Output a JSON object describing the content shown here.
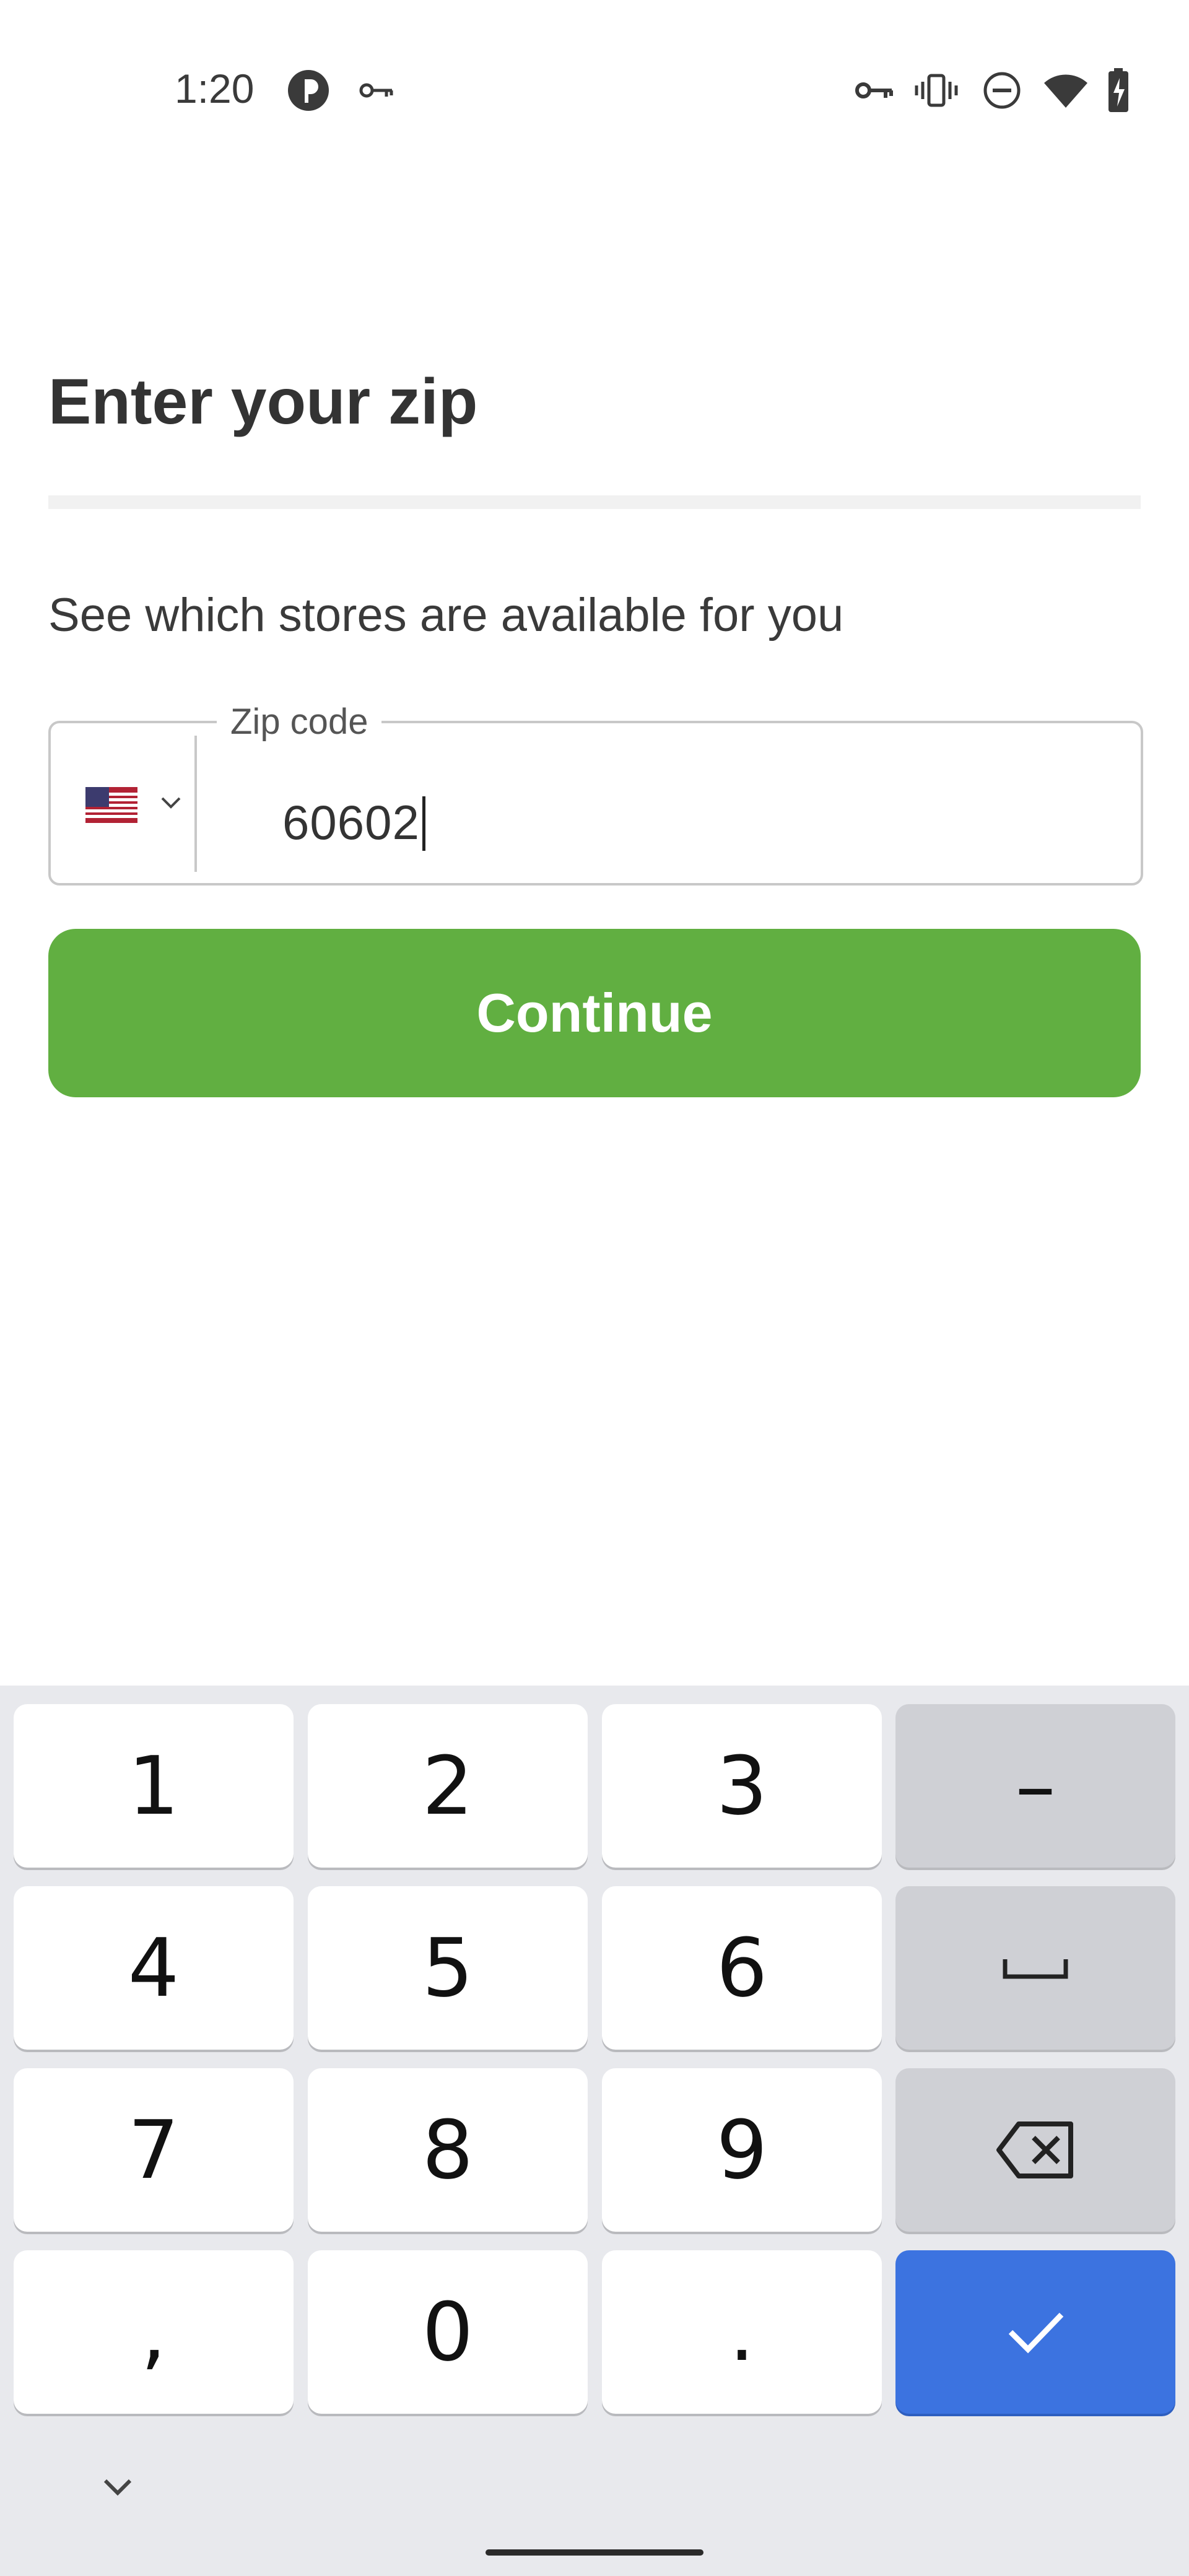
{
  "status_bar": {
    "time": "1:20",
    "left_icons": [
      "assistant-icon",
      "vpn-key-icon"
    ],
    "right_icons": [
      "vpn-key-icon",
      "vibrate-icon",
      "do-not-disturb-icon",
      "wifi-icon",
      "battery-charging-icon"
    ]
  },
  "page": {
    "title": "Enter your zip",
    "progress_fraction": 0.0,
    "subtitle": "See which stores are available for you"
  },
  "zip_field": {
    "country_flag": "us-flag-icon",
    "label": "Zip code",
    "value": "60602"
  },
  "continue_button": {
    "label": "Continue"
  },
  "keyboard": {
    "keys": [
      {
        "label": "1",
        "name": "key-1"
      },
      {
        "label": "2",
        "name": "key-2"
      },
      {
        "label": "3",
        "name": "key-3"
      },
      {
        "label": "–",
        "name": "key-dash"
      },
      {
        "label": "4",
        "name": "key-4"
      },
      {
        "label": "5",
        "name": "key-5"
      },
      {
        "label": "6",
        "name": "key-6"
      },
      {
        "label": "",
        "name": "key-space",
        "icon": "space-icon"
      },
      {
        "label": "7",
        "name": "key-7"
      },
      {
        "label": "8",
        "name": "key-8"
      },
      {
        "label": "9",
        "name": "key-9"
      },
      {
        "label": "",
        "name": "key-backspace",
        "icon": "backspace-icon"
      },
      {
        "label": ",",
        "name": "key-comma"
      },
      {
        "label": "0",
        "name": "key-0"
      },
      {
        "label": ".",
        "name": "key-period"
      },
      {
        "label": "",
        "name": "key-done",
        "icon": "checkmark-icon"
      }
    ]
  },
  "colors": {
    "accent_green": "#61af41",
    "keyboard_action_blue": "#3c73e0",
    "keyboard_background": "#e8e9ed"
  }
}
